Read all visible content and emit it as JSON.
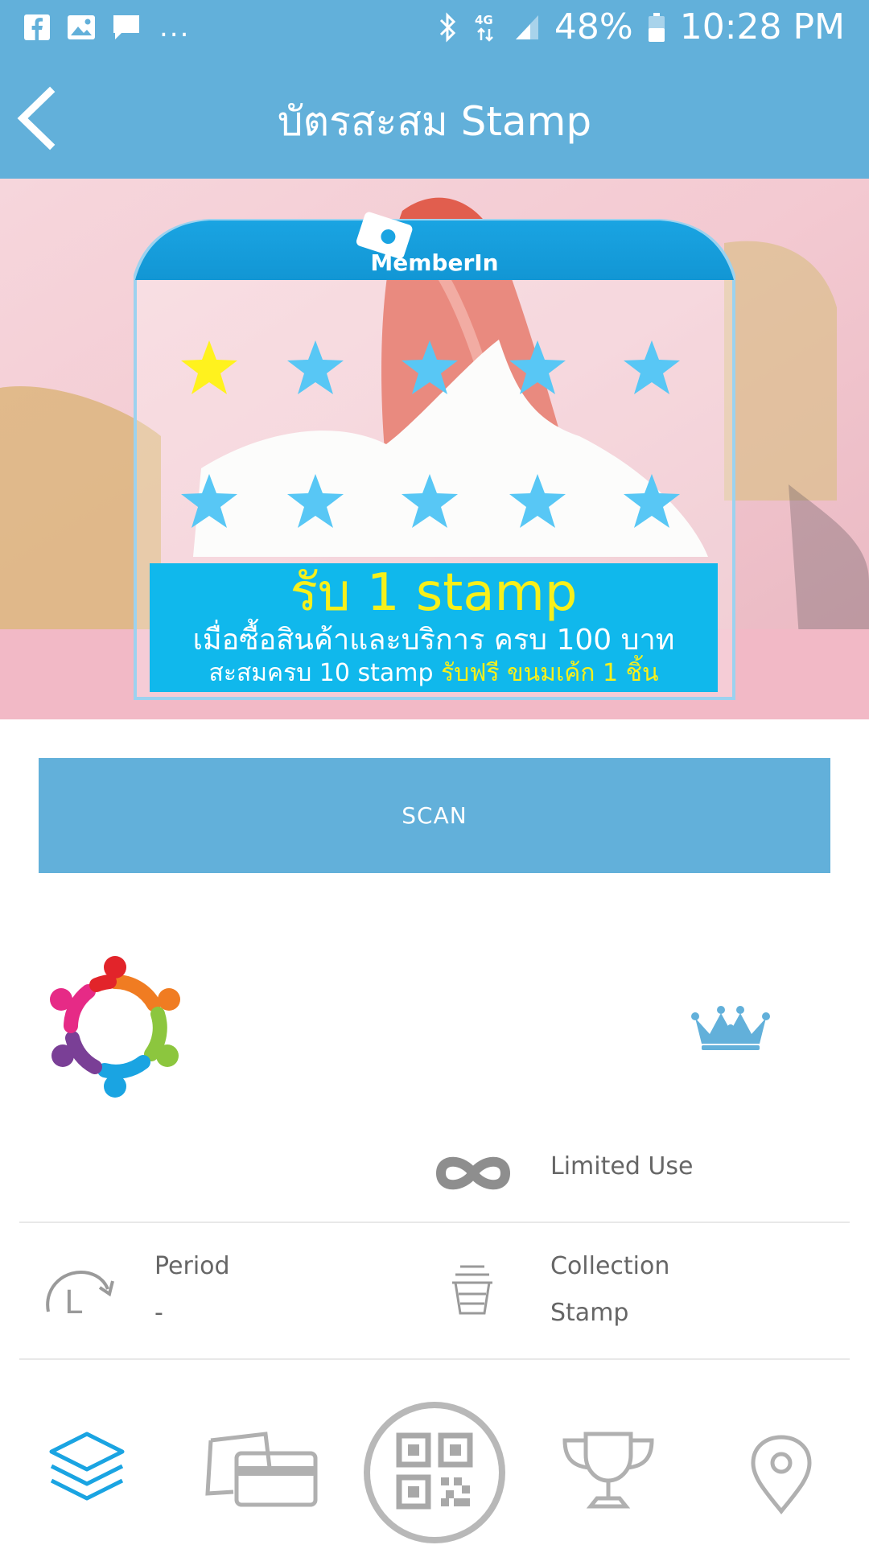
{
  "status_bar": {
    "left_icons": [
      "facebook-icon",
      "gallery-icon",
      "message-icon"
    ],
    "overflow": "...",
    "right_icons": [
      "bluetooth-icon",
      "4g-icon",
      "signal-icon",
      "battery-icon"
    ],
    "battery_percent": "48%",
    "network": "4G",
    "time": "10:28 PM"
  },
  "header": {
    "title": "บัตรสะสม Stamp",
    "back_icon": "chevron-left-icon"
  },
  "banner": {
    "card_brand": "MemberIn",
    "stamps_total": 10,
    "stamps_collected": 1,
    "promo_main": "รับ 1 stamp",
    "promo_line1": "เมื่อซื้อสินค้าและบริการ ครบ 100 บาท",
    "promo_line2_prefix": "สะสมครบ 10 stamp",
    "promo_line2_highlight": "รับฟรี ขนมเค้ก 1 ชิ้น",
    "colors": {
      "collected": "#fff21e",
      "empty": "#58c7f5",
      "promo_bg": "#10b8ec",
      "accent": "#1aa4e2"
    }
  },
  "scan_button": {
    "label": "SCAN"
  },
  "info": {
    "usage_icon": "infinity-icon",
    "usage_label": "Limited Use",
    "period_icon": "clock-rotate-icon",
    "period_label": "Period",
    "period_value": "-",
    "collection_icon": "cup-icon",
    "collection_label": "Collection",
    "collection_value": "Stamp"
  },
  "bottom_nav": {
    "items": [
      {
        "icon": "layers-icon",
        "active": true
      },
      {
        "icon": "cards-icon",
        "active": false
      },
      {
        "icon": "qr-code-icon",
        "active": false
      },
      {
        "icon": "trophy-icon",
        "active": false
      },
      {
        "icon": "location-pin-icon",
        "active": false
      }
    ]
  },
  "theme": {
    "primary": "#62b0da",
    "text": "#666666",
    "icon_gray": "#9a9a9a",
    "nav_active": "#1aa4e2"
  }
}
